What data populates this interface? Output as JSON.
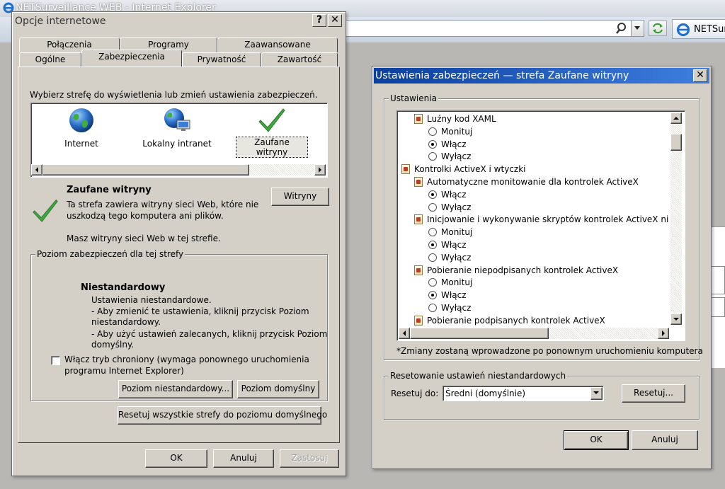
{
  "ie": {
    "title": "NETSurveillance WEB - Internet Explorer",
    "tab_label": "NETSurv"
  },
  "options_dialog": {
    "title": "Opcje internetowe",
    "help_glyph": "?",
    "close_glyph": "✕",
    "tabs_row1": [
      "Połączenia",
      "Programy",
      "Zaawansowane"
    ],
    "tabs_row2": [
      "Ogólne",
      "Zabezpieczenia",
      "Prywatność",
      "Zawartość"
    ],
    "active_tab": "Zabezpieczenia",
    "zone_prompt": "Wybierz strefę do wyświetlenia lub zmień ustawienia zabezpieczeń.",
    "zones": [
      "Internet",
      "Lokalny intranet",
      "Zaufane witryny"
    ],
    "selected_zone": "Zaufane witryny",
    "zone_title": "Zaufane witryny",
    "zone_desc_1": "Ta strefa zawiera witryny sieci Web, które nie",
    "zone_desc_2": "uszkodzą tego komputera ani plików.",
    "zone_sites_note": "Masz witryny sieci Web w tej strefie.",
    "sites_button": "Witryny",
    "level_group": "Poziom zabezpieczeń dla tej strefy",
    "level_title": "Niestandardowy",
    "level_lines": [
      "Ustawienia niestandardowe.",
      "- Aby zmienić te ustawienia, kliknij przycisk Poziom",
      "niestandardowy.",
      "- Aby użyć ustawień zalecanych, kliknij przycisk Poziom",
      "domyślny."
    ],
    "protected_mode_1": "Włącz tryb chroniony (wymaga ponownego uruchomienia",
    "protected_mode_2": "programu Internet Explorer)",
    "protected_mode_checked": false,
    "custom_level_button": "Poziom niestandardowy...",
    "default_level_button": "Poziom domyślny",
    "reset_all_button": "Resetuj wszystkie strefy do poziomu domyślnego",
    "ok_button": "OK",
    "cancel_button": "Anuluj",
    "apply_button": "Zastosuj"
  },
  "security_dialog": {
    "title": "Ustawienia zabezpieczeń — strefa Zaufane witryny",
    "close_glyph": "✕",
    "settings_group": "Ustawienia",
    "tree": [
      {
        "type": "header",
        "icon": "xaml-icon",
        "label": "Luźny kod XAML",
        "indent": 1
      },
      {
        "type": "radio",
        "label": "Monituj",
        "checked": false,
        "indent": 2
      },
      {
        "type": "radio",
        "label": "Włącz",
        "checked": true,
        "indent": 2
      },
      {
        "type": "radio",
        "label": "Wyłącz",
        "checked": false,
        "indent": 2
      },
      {
        "type": "header",
        "icon": "activex-icon",
        "label": "Kontrolki ActiveX i wtyczki",
        "indent": 0
      },
      {
        "type": "header",
        "icon": "setting-icon",
        "label": "Automatyczne monitowanie dla kontrolek ActiveX",
        "indent": 1
      },
      {
        "type": "radio",
        "label": "Włącz",
        "checked": true,
        "indent": 2
      },
      {
        "type": "radio",
        "label": "Wyłącz",
        "checked": false,
        "indent": 2
      },
      {
        "type": "header",
        "icon": "setting-icon",
        "label": "Inicjowanie i wykonywanie skryptów kontrolek ActiveX niezaz",
        "indent": 1
      },
      {
        "type": "radio",
        "label": "Monituj",
        "checked": false,
        "indent": 2
      },
      {
        "type": "radio",
        "label": "Włącz",
        "checked": true,
        "indent": 2
      },
      {
        "type": "radio",
        "label": "Wyłącz",
        "checked": false,
        "indent": 2
      },
      {
        "type": "header",
        "icon": "setting-icon",
        "label": "Pobieranie niepodpisanych kontrolek ActiveX",
        "indent": 1
      },
      {
        "type": "radio",
        "label": "Monituj",
        "checked": false,
        "indent": 2
      },
      {
        "type": "radio",
        "label": "Włącz",
        "checked": true,
        "indent": 2
      },
      {
        "type": "radio",
        "label": "Wyłącz",
        "checked": false,
        "indent": 2
      },
      {
        "type": "header",
        "icon": "setting-icon",
        "label": "Pobieranie podpisanych kontrolek ActiveX",
        "indent": 1
      }
    ],
    "restart_note": "*Zmiany zostaną wprowadzone po ponownym uruchomieniu komputera",
    "reset_group": "Resetowanie ustawień niestandardowych",
    "reset_to_label": "Resetuj do:",
    "reset_to_value": "Średni (domyślnie)",
    "reset_button": "Resetuj...",
    "ok_button": "OK",
    "cancel_button": "Anuluj"
  },
  "colors": {
    "dialog_face": "#d4d0c8",
    "zone_check_green": "#3ea83e",
    "globe_blue": "#2a6fc9"
  }
}
